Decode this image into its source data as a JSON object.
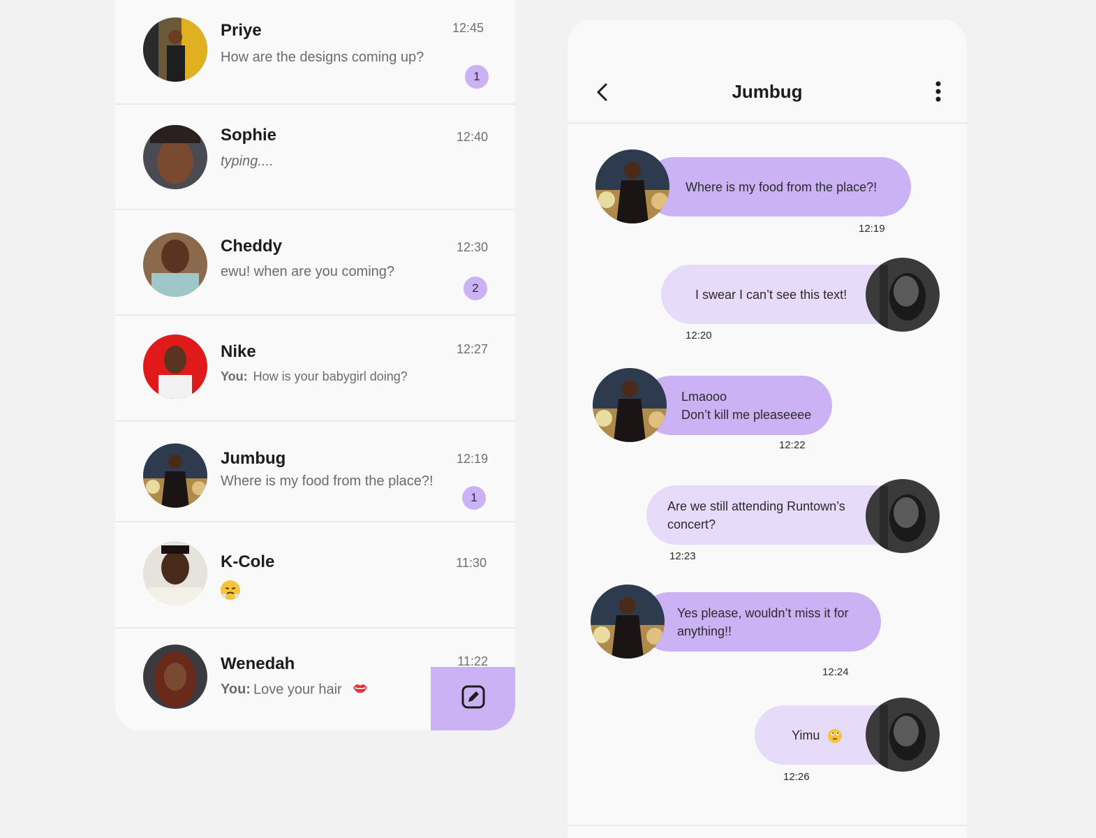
{
  "chat_list": [
    {
      "name": "Priye",
      "time": "12:45",
      "preview": "How are the designs coming up?",
      "unread": "1"
    },
    {
      "name": "Sophie",
      "time": "12:40",
      "preview": "typing...."
    },
    {
      "name": "Cheddy",
      "time": "12:30",
      "preview": "ewu! when are you coming?",
      "unread": "2"
    },
    {
      "name": "Nike",
      "time": "12:27",
      "you_label": "You:",
      "preview": "How is your babygirl doing?"
    },
    {
      "name": "Jumbug",
      "time": "12:19",
      "preview": "Where is my food from the place?!",
      "unread": "1"
    },
    {
      "name": "K-Cole",
      "time": "11:30",
      "preview_icon": "steaming-face-emoji"
    },
    {
      "name": "Wenedah",
      "time": "11:22",
      "you_label": "You:",
      "preview": "Love your hair",
      "preview_icon": "kiss-lips-emoji"
    }
  ],
  "compose_icon": "edit-icon",
  "conversation": {
    "title": "Jumbug",
    "back_icon": "chevron-left-icon",
    "menu_icon": "more-vertical-icon",
    "messages": [
      {
        "direction": "in",
        "lines": [
          "Where is my food from the place?!"
        ],
        "time": "12:19"
      },
      {
        "direction": "out",
        "lines": [
          "I swear I can’t see this text!"
        ],
        "time": "12:20"
      },
      {
        "direction": "in",
        "lines": [
          "Lmaooo",
          "Don’t kill me pleaseeee"
        ],
        "time": "12:22"
      },
      {
        "direction": "out",
        "lines": [
          "Are we still attending Runtown’s",
          "concert?"
        ],
        "time": "12:23"
      },
      {
        "direction": "in",
        "lines": [
          "Yes please, wouldn’t miss it for",
          "anything!!"
        ],
        "time": "12:24"
      },
      {
        "direction": "out",
        "lines": [
          "Yimu"
        ],
        "time": "12:26",
        "icon": "eye-roll-emoji"
      }
    ]
  },
  "colors": {
    "accent": "#cbb2f4",
    "accent_light": "#e7dbfa",
    "panel": "#f9f9f9",
    "background": "#f2f2f2"
  }
}
